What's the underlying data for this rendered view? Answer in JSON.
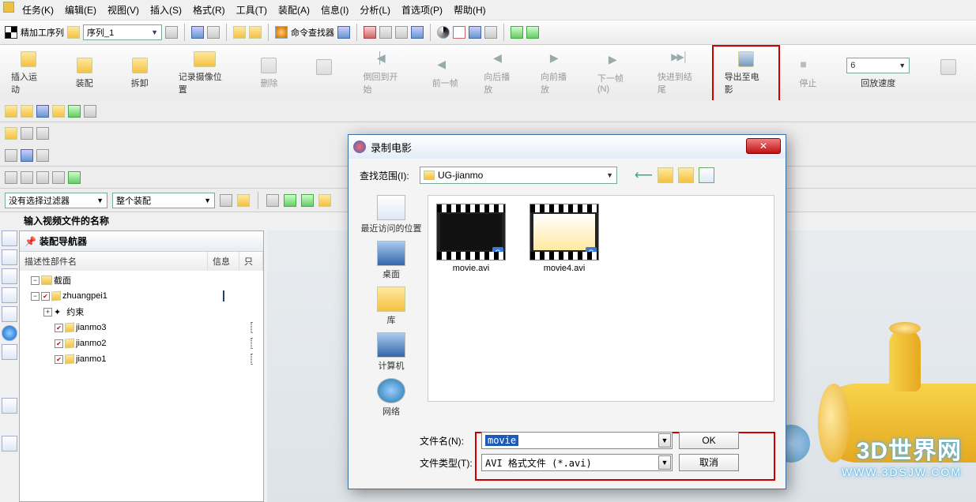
{
  "menu": {
    "items": [
      "任务(K)",
      "编辑(E)",
      "视图(V)",
      "插入(S)",
      "格式(R)",
      "工具(T)",
      "装配(A)",
      "信息(I)",
      "分析(L)",
      "首选项(P)",
      "帮助(H)"
    ]
  },
  "toolbar1": {
    "seq_label": "精加工序列",
    "seq_value": "序列_1",
    "cmd_finder": "命令查找器"
  },
  "ribbon": {
    "btns": [
      {
        "label": "插入运动",
        "dim": false
      },
      {
        "label": "装配",
        "dim": false
      },
      {
        "label": "拆卸",
        "dim": false
      },
      {
        "label": "记录摄像位置",
        "dim": false
      },
      {
        "label": "删除",
        "dim": true
      }
    ],
    "play": [
      {
        "label": "倒回到开始",
        "cls": "arrow-first"
      },
      {
        "label": "前一帧",
        "cls": "arrow-prev"
      },
      {
        "label": "向后播放",
        "cls": "arrow-back"
      },
      {
        "label": "向前播放",
        "cls": "arrow-play"
      },
      {
        "label": "下一帧(N)",
        "cls": "arrow-next"
      },
      {
        "label": "快进到结尾",
        "cls": "arrow-last"
      }
    ],
    "export": "导出至电影",
    "stop": "停止",
    "speed_label": "回放速度",
    "speed_value": "6"
  },
  "filters": {
    "a": "没有选择过滤器",
    "b": "整个装配"
  },
  "instruction": "输入视频文件的名称",
  "tree": {
    "title": "装配导航器",
    "cols": [
      "描述性部件名",
      "信息",
      "只"
    ],
    "nodes": {
      "sections": "截面",
      "root": "zhuangpei1",
      "constraint": "约束",
      "children": [
        "jianmo3",
        "jianmo2",
        "jianmo1"
      ]
    }
  },
  "watermark": {
    "l1": "3D世界网",
    "l2": "WWW.3DSJW.COM"
  },
  "dialog": {
    "title": "录制电影",
    "look_label": "查找范围(I):",
    "look_value": "UG-jianmo",
    "places": [
      "最近访问的位置",
      "桌面",
      "库",
      "计算机",
      "网络"
    ],
    "files": [
      "movie.avi",
      "movie4.avi"
    ],
    "fname_label": "文件名(N):",
    "fname_value": "movie",
    "ftype_label": "文件类型(T):",
    "ftype_value": "AVI 格式文件 (*.avi)",
    "ok": "OK",
    "cancel": "取消"
  }
}
